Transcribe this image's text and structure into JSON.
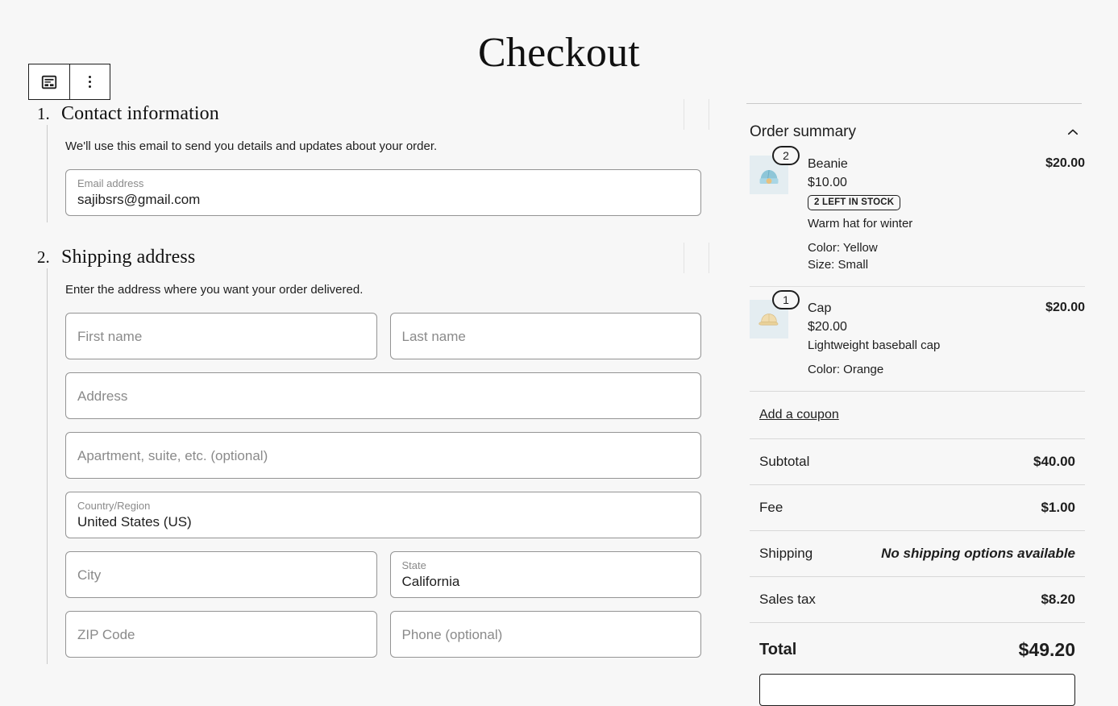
{
  "page": {
    "title": "Checkout"
  },
  "block_toolbar": {
    "form_block_icon": "form-block-icon",
    "options_icon": "vertical-dots-icon"
  },
  "steps": [
    {
      "number": "1.",
      "title": "Contact information",
      "description": "We'll use this email to send you details and updates about your order.",
      "fields": [
        {
          "label": "Email address",
          "value": "sajibsrs@gmail.com",
          "placeholder": ""
        }
      ]
    },
    {
      "number": "2.",
      "title": "Shipping address",
      "description": "Enter the address where you want your order delivered.",
      "fields": [
        {
          "label": "",
          "value": "",
          "placeholder": "First name"
        },
        {
          "label": "",
          "value": "",
          "placeholder": "Last name"
        },
        {
          "label": "",
          "value": "",
          "placeholder": "Address"
        },
        {
          "label": "",
          "value": "",
          "placeholder": "Apartment, suite, etc. (optional)"
        },
        {
          "label": "Country/Region",
          "value": "United States (US)",
          "placeholder": ""
        },
        {
          "label": "",
          "value": "",
          "placeholder": "City"
        },
        {
          "label": "State",
          "value": "California",
          "placeholder": ""
        },
        {
          "label": "",
          "value": "",
          "placeholder": "ZIP Code"
        },
        {
          "label": "",
          "value": "",
          "placeholder": "Phone (optional)"
        }
      ]
    }
  ],
  "order_summary": {
    "heading": "Order summary",
    "collapse_icon": "chevron-up-icon",
    "items": [
      {
        "quantity": "2",
        "name": "Beanie",
        "unit_price": "$10.00",
        "stock_badge": "2 LEFT IN STOCK",
        "description": "Warm hat for winter",
        "variants": [
          "Color: Yellow",
          "Size: Small"
        ],
        "line_total": "$20.00",
        "thumb_icon": "beanie-thumbnail"
      },
      {
        "quantity": "1",
        "name": "Cap",
        "unit_price": "$20.00",
        "stock_badge": "",
        "description": "Lightweight baseball cap",
        "variants": [
          "Color: Orange"
        ],
        "line_total": "$20.00",
        "thumb_icon": "cap-thumbnail"
      }
    ],
    "coupon_link": "Add a coupon",
    "totals": [
      {
        "label": "Subtotal",
        "value": "$40.00",
        "italic": false
      },
      {
        "label": "Fee",
        "value": "$1.00",
        "italic": false
      },
      {
        "label": "Shipping",
        "value": "No shipping options available",
        "italic": true
      },
      {
        "label": "Sales tax",
        "value": "$8.20",
        "italic": false
      }
    ],
    "grand_total": {
      "label": "Total",
      "value": "$49.20"
    }
  },
  "colors": {
    "background": "#f7f7f7",
    "text": "#1e1e1e",
    "border": "#949494",
    "muted": "#8a8a8a",
    "thumb_bg": "#e4edf1"
  }
}
